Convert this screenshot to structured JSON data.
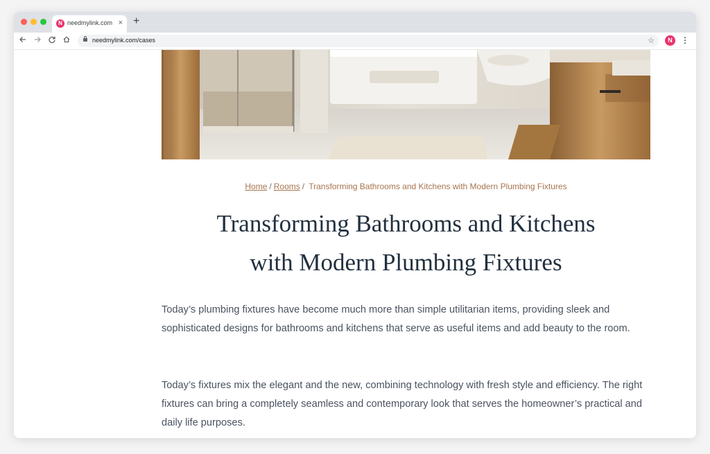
{
  "browser": {
    "tab_title": "needmylink.com",
    "favicon_letter": "N",
    "close_glyph": "×",
    "newtab_glyph": "+",
    "url": "needmylink.com/cases",
    "profile_letter": "N",
    "icons": [
      "back-icon",
      "forward-icon",
      "reload-icon",
      "home-icon",
      "lock-icon",
      "star-icon",
      "menu-icon"
    ]
  },
  "breadcrumb": {
    "home": "Home",
    "separator": "/",
    "rooms": "Rooms",
    "current": "Transforming Bathrooms and Kitchens with Modern Plumbing Fixtures"
  },
  "article": {
    "title_line1": "Transforming Bathrooms and Kitchens",
    "title_line2": "with Modern Plumbing Fixtures",
    "paragraphs": [
      "Today’s plumbing fixtures have become much more than simple utilitarian items, providing sleek and sophisticated designs for bathrooms and kitchens that serve as useful items and add beauty to the room.",
      "Today’s fixtures mix the elegant and the new, combining technology with fresh style and efficiency. The right fixtures can bring a completely seamless and contemporary look that serves the homeowner’s practical and daily life purposes."
    ]
  },
  "colors": {
    "link": "#a8744e",
    "title": "#22303f",
    "body_text": "#4a5260",
    "brand": "#e8336b"
  }
}
